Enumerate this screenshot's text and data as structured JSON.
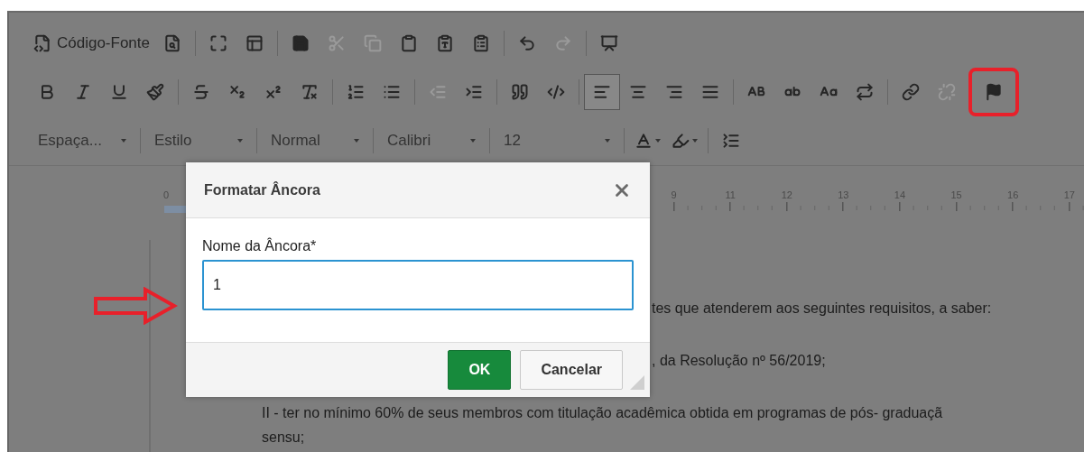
{
  "toolbar": {
    "rows": [
      [
        {
          "kind": "source",
          "label": "Código-Fonte",
          "disabled": false
        },
        {
          "kind": "preview",
          "disabled": false
        },
        {
          "kind": "sep"
        },
        {
          "kind": "maximize",
          "disabled": false
        },
        {
          "kind": "blocks",
          "disabled": false
        },
        {
          "kind": "sep"
        },
        {
          "kind": "save",
          "disabled": false
        },
        {
          "kind": "cut",
          "disabled": true
        },
        {
          "kind": "copy",
          "disabled": true
        },
        {
          "kind": "paste",
          "disabled": false
        },
        {
          "kind": "pastetext",
          "disabled": false
        },
        {
          "kind": "pasteword",
          "disabled": false
        },
        {
          "kind": "sep"
        },
        {
          "kind": "undo",
          "disabled": false
        },
        {
          "kind": "redo",
          "disabled": true
        },
        {
          "kind": "sep"
        },
        {
          "kind": "template",
          "disabled": false
        }
      ],
      [
        {
          "kind": "bold",
          "disabled": false,
          "selected": false
        },
        {
          "kind": "italic",
          "disabled": false,
          "selected": false
        },
        {
          "kind": "underline",
          "disabled": false,
          "selected": false
        },
        {
          "kind": "painter",
          "disabled": false,
          "selected": false
        },
        {
          "kind": "sep"
        },
        {
          "kind": "strike",
          "disabled": false,
          "selected": false
        },
        {
          "kind": "sub",
          "disabled": false,
          "selected": false
        },
        {
          "kind": "sup",
          "disabled": false,
          "selected": false
        },
        {
          "kind": "clearformat",
          "disabled": false,
          "selected": false
        },
        {
          "kind": "sep"
        },
        {
          "kind": "numbered",
          "disabled": false,
          "selected": false
        },
        {
          "kind": "bulleted",
          "disabled": false,
          "selected": false
        },
        {
          "kind": "sep"
        },
        {
          "kind": "outdent",
          "disabled": true,
          "selected": false
        },
        {
          "kind": "indent",
          "disabled": false,
          "selected": false
        },
        {
          "kind": "sep"
        },
        {
          "kind": "quote",
          "disabled": false,
          "selected": false
        },
        {
          "kind": "div",
          "disabled": false,
          "selected": false
        },
        {
          "kind": "sep"
        },
        {
          "kind": "alignleft",
          "disabled": false,
          "selected": true
        },
        {
          "kind": "aligncenter",
          "disabled": false,
          "selected": false
        },
        {
          "kind": "alignright",
          "disabled": false,
          "selected": false
        },
        {
          "kind": "justify",
          "disabled": false,
          "selected": false
        },
        {
          "kind": "sep"
        },
        {
          "kind": "upper",
          "disabled": false,
          "selected": false
        },
        {
          "kind": "lower",
          "disabled": false,
          "selected": false
        },
        {
          "kind": "title",
          "disabled": false,
          "selected": false
        },
        {
          "kind": "togglecase",
          "disabled": false,
          "selected": false
        },
        {
          "kind": "sep"
        },
        {
          "kind": "link",
          "disabled": false,
          "selected": false
        },
        {
          "kind": "unlink",
          "disabled": true,
          "selected": false
        },
        {
          "kind": "anchor",
          "disabled": false,
          "selected": false,
          "circled": true
        }
      ],
      [
        {
          "kind": "dropdown",
          "label": "Espaça..."
        },
        {
          "kind": "sep"
        },
        {
          "kind": "dropdown",
          "label": "Estilo"
        },
        {
          "kind": "sep"
        },
        {
          "kind": "dropdown",
          "label": "Normal"
        },
        {
          "kind": "sep"
        },
        {
          "kind": "dropdown",
          "label": "Calibri"
        },
        {
          "kind": "sep"
        },
        {
          "kind": "dropdown",
          "label": "12",
          "wide": true
        },
        {
          "kind": "sep"
        },
        {
          "kind": "textcolor"
        },
        {
          "kind": "bgcolor"
        },
        {
          "kind": "sep"
        },
        {
          "kind": "lineheight"
        }
      ]
    ]
  },
  "ruler": {
    "numbers": [
      "0",
      "9",
      "11",
      "12",
      "13",
      "14",
      "15",
      "16",
      "17"
    ]
  },
  "document": {
    "lines": [
      {
        "kind": "covered",
        "text": "tes que atenderem aos seguintes requisitos, a saber:"
      },
      {
        "kind": "covered",
        "text": ", da Resolução nº 56/2019;"
      },
      {
        "kind": "full",
        "text": "II - ter no mínimo 60% de seus membros com titulação acadêmica obtida em programas de pós- graduaçã"
      },
      {
        "kind": "continued",
        "text": "sensu;"
      }
    ]
  },
  "dialog": {
    "title": "Formatar Âncora",
    "field": {
      "label": "Nome da Âncora*",
      "value": "1",
      "focused": true
    },
    "buttons": [
      {
        "kind": "primary",
        "label": "OK"
      },
      {
        "kind": "secondary",
        "label": "Cancelar"
      }
    ]
  },
  "annotation": {
    "arrow": true
  }
}
